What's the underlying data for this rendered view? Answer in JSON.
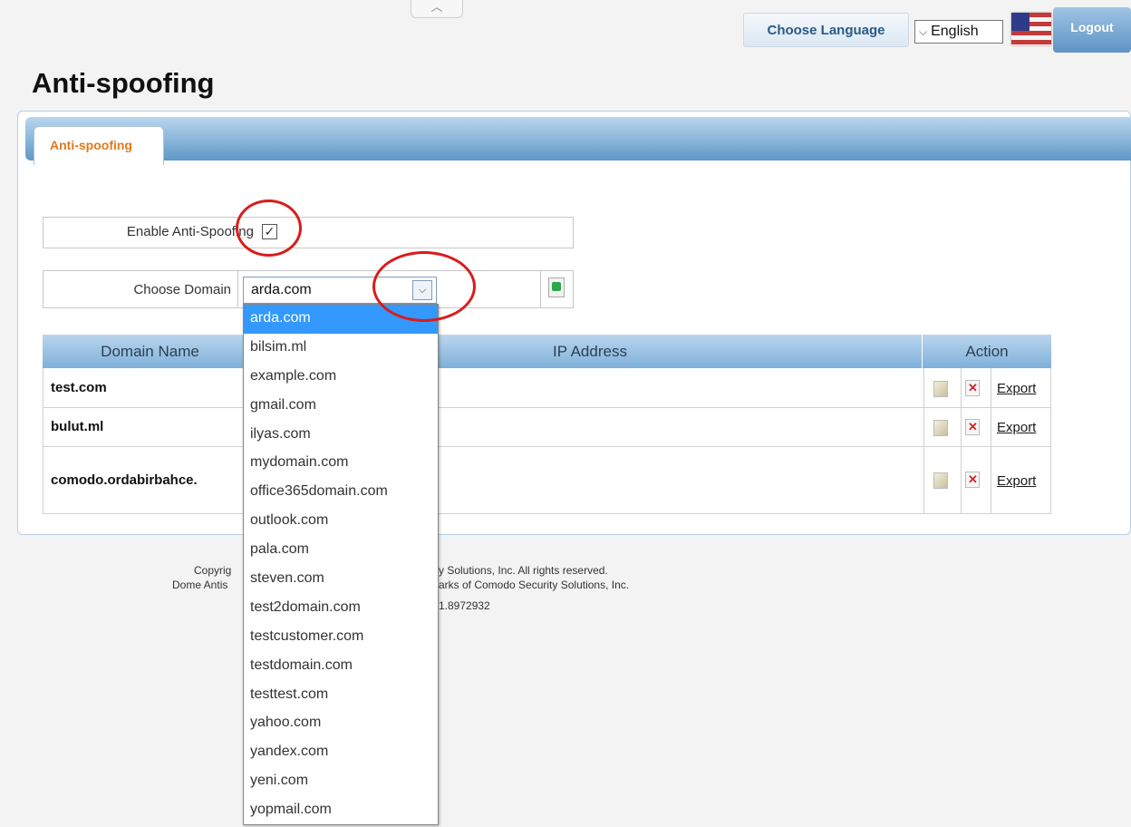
{
  "header": {
    "choose_language_label": "Choose Language",
    "language_value": "English",
    "logout_label": "Logout"
  },
  "page": {
    "title": "Anti-spoofing"
  },
  "tabs": [
    {
      "label": "Anti-spoofing",
      "active": true
    }
  ],
  "form": {
    "enable_label": "Enable Anti-Spoofing",
    "enable_checked": true,
    "choose_domain_label": "Choose Domain",
    "domain_value": "arda.com"
  },
  "table": {
    "columns": [
      "Domain Name",
      "IP Address",
      "Action"
    ],
    "rows": [
      {
        "domain": "test.com",
        "export": "Export"
      },
      {
        "domain": "bulut.ml",
        "export": "Export"
      },
      {
        "domain": "comodo.ordabirbahce.",
        "export": "Export"
      }
    ]
  },
  "dropdown": {
    "options": [
      "arda.com",
      "bilsim.ml",
      "example.com",
      "gmail.com",
      "ilyas.com",
      "mydomain.com",
      "office365domain.com",
      "outlook.com",
      "pala.com",
      "steven.com",
      "test2domain.com",
      "testcustomer.com",
      "testdomain.com",
      "testtest.com",
      "yahoo.com",
      "yandex.com",
      "yeni.com",
      "yopmail.com"
    ],
    "selected_index": 0
  },
  "footer": {
    "line1_left": "Copyrig",
    "line1_right": "y Solutions, Inc. All rights reserved.",
    "line2_left": "Dome Antis",
    "line2_right": "arks of Comodo Security Solutions, Inc.",
    "line3_right": "1.8972932"
  },
  "colors": {
    "accent_blue": "#5f98c7",
    "tab_text_orange": "#e07a1d",
    "selection_blue": "#3399ff",
    "annotation_red": "#d91c1c"
  }
}
